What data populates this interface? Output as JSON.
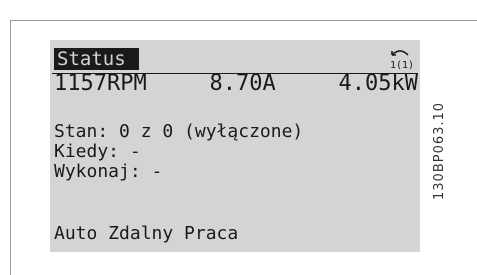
{
  "lcd": {
    "status_title": "Status",
    "status_icon": "remote-control-icon",
    "readouts": {
      "speed": "1157RPM",
      "current": "8.70A",
      "power": "4.05kW"
    },
    "state_line": "Stan: 0 z 0 (wyłączone)",
    "when_line": "Kiedy: -",
    "execute_line": "Wykonaj: -",
    "mode_line": "Auto Zdalny Praca"
  },
  "figure_code": "130BP063.10"
}
